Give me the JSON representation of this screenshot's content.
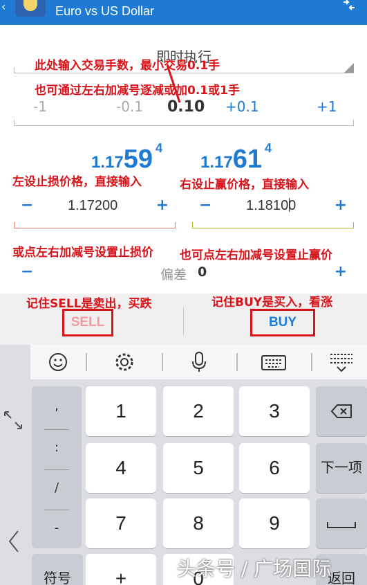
{
  "header": {
    "title": "Euro vs US Dollar"
  },
  "order": {
    "type_label": "即时执行"
  },
  "volume": {
    "minus_1": "-1",
    "minus_01": "-0.1",
    "value": "0.10",
    "plus_01": "+0.1",
    "plus_1": "+1"
  },
  "prices": {
    "bid": {
      "prefix": "1.17",
      "big": "59",
      "sup": "4"
    },
    "ask": {
      "prefix": "1.17",
      "big": "61",
      "sup": "4"
    }
  },
  "stop_loss": {
    "minus": "−",
    "value": "1.17200",
    "plus": "+"
  },
  "take_profit": {
    "minus": "−",
    "value_before_caret": "1.181",
    "value_after_caret": "00",
    "plus": "+"
  },
  "deviation": {
    "minus": "−",
    "label": "偏差",
    "value": "0",
    "plus": "+"
  },
  "actions": {
    "sell_label": "SELL",
    "buy_label": "BUY"
  },
  "keyboard": {
    "symbols": [
      ",",
      ":",
      "/",
      "-"
    ],
    "keys": [
      "1",
      "2",
      "3",
      "4",
      "5",
      "6",
      "7",
      "8",
      "9",
      "+",
      "0"
    ],
    "next_label": "下一项",
    "symbols_label": "符号",
    "return_label": "返回"
  },
  "annotations": {
    "volume_input": "此处输入交易手数，最小交易0.1手",
    "volume_adjust": "也可通过左右加减号逐减或加0.1或1手",
    "sl_input": "左设止损价格，直接输入",
    "tp_input": "右设止赢价格，直接输入",
    "sl_adjust": "或点左右加减号设置止损价",
    "tp_adjust": "也可点左右加减号设置止赢价",
    "sell_note": "记住SELL是卖出，买跌",
    "buy_note": "记住BUY是买入，看涨"
  },
  "watermark": "头条号 / 广场国际",
  "colors": {
    "header": "#1f7ad3",
    "accent": "#1f7ad3",
    "annotation": "#d8141a",
    "stop_loss_line": "#e07a6a",
    "take_profit_line": "#a8b62a"
  }
}
